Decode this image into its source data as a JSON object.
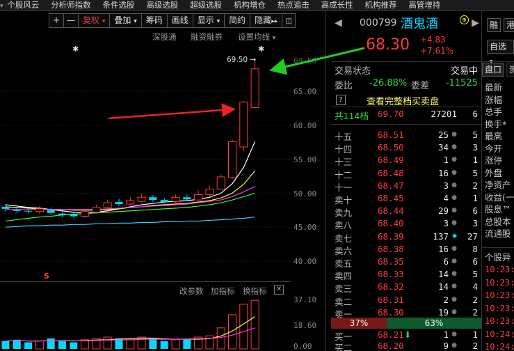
{
  "top_menu": [
    "个股风云",
    "分析师指数",
    "条件选股",
    "高级选股",
    "超级选股",
    "机构增仓",
    "热点追击",
    "高成长性",
    "机构推荐",
    "高管增持"
  ],
  "toolbar": {
    "plus": "+",
    "minus": "—",
    "restore": "复权",
    "overlay": "叠加",
    "chips": "筹码",
    "draw": "画线",
    "display": "显示",
    "simple": "简约",
    "hide": "隐藏"
  },
  "subbar": {
    "sgt": "深股通",
    "margin": "融资融券",
    "ma_settings": "设置均线"
  },
  "price_axis": [
    "65.00",
    "60.00",
    "55.00",
    "50.00",
    "45.00",
    "40.00"
  ],
  "price_axis_top": "69.50",
  "high_label": "69.50",
  "s_marker": "S",
  "vol_bar": {
    "params": "改参数",
    "add_ind": "加指标",
    "switch_ind": "换指标"
  },
  "vol_axis": [
    "37.10",
    "18.60",
    "0.00"
  ],
  "colors": {
    "up": "#ff3a3a",
    "down": "#00d8ff",
    "green": "#33d633",
    "bg": "#000000"
  },
  "chart_data": {
    "type": "candlestick",
    "ylim": [
      37,
      70
    ],
    "candles": [
      {
        "o": 48.0,
        "c": 47.7,
        "h": 48.4,
        "l": 47.3
      },
      {
        "o": 47.6,
        "c": 47.4,
        "h": 48.0,
        "l": 47.1
      },
      {
        "o": 47.4,
        "c": 47.3,
        "h": 47.8,
        "l": 47.0
      },
      {
        "o": 47.3,
        "c": 47.7,
        "h": 48.1,
        "l": 47.0
      },
      {
        "o": 47.5,
        "c": 47.1,
        "h": 47.9,
        "l": 46.8
      },
      {
        "o": 47.0,
        "c": 46.8,
        "h": 47.3,
        "l": 46.5
      },
      {
        "o": 46.9,
        "c": 46.6,
        "h": 47.2,
        "l": 46.4
      },
      {
        "o": 46.6,
        "c": 47.3,
        "h": 47.6,
        "l": 46.4
      },
      {
        "o": 47.2,
        "c": 47.9,
        "h": 48.3,
        "l": 47.0
      },
      {
        "o": 47.9,
        "c": 48.6,
        "h": 49.0,
        "l": 47.7
      },
      {
        "o": 48.7,
        "c": 48.4,
        "h": 49.2,
        "l": 48.1
      },
      {
        "o": 48.4,
        "c": 48.9,
        "h": 49.4,
        "l": 48.2
      },
      {
        "o": 48.8,
        "c": 49.4,
        "h": 49.9,
        "l": 48.6
      },
      {
        "o": 49.4,
        "c": 49.0,
        "h": 49.7,
        "l": 48.7
      },
      {
        "o": 49.0,
        "c": 48.7,
        "h": 49.3,
        "l": 48.5
      },
      {
        "o": 48.8,
        "c": 49.4,
        "h": 49.8,
        "l": 48.6
      },
      {
        "o": 49.4,
        "c": 49.1,
        "h": 49.8,
        "l": 48.9
      },
      {
        "o": 49.0,
        "c": 49.8,
        "h": 50.4,
        "l": 48.9
      },
      {
        "o": 49.8,
        "c": 50.6,
        "h": 51.1,
        "l": 49.6
      },
      {
        "o": 50.6,
        "c": 52.4,
        "h": 52.8,
        "l": 50.5
      },
      {
        "o": 52.3,
        "c": 57.6,
        "h": 57.9,
        "l": 52.1
      },
      {
        "o": 56.8,
        "c": 63.4,
        "h": 63.6,
        "l": 56.2
      },
      {
        "o": 62.6,
        "c": 68.3,
        "h": 69.5,
        "l": 62.4
      }
    ],
    "ma_lines": [
      {
        "color": "#ffffff",
        "values": [
          48.3,
          48.1,
          47.9,
          47.8,
          47.6,
          47.4,
          47.2,
          47.1,
          47.2,
          47.4,
          47.7,
          48.0,
          48.3,
          48.5,
          48.7,
          48.8,
          48.9,
          49.1,
          49.4,
          50.0,
          51.4,
          53.8,
          57.6
        ]
      },
      {
        "color": "#ffff33",
        "values": [
          48.0,
          47.9,
          47.8,
          47.7,
          47.6,
          47.6,
          47.5,
          47.5,
          47.5,
          47.6,
          47.7,
          47.9,
          48.0,
          48.2,
          48.3,
          48.4,
          48.5,
          48.7,
          48.9,
          49.3,
          50.0,
          51.3,
          53.3
        ]
      },
      {
        "color": "#ff33ff",
        "values": [
          47.6,
          47.6,
          47.6,
          47.6,
          47.6,
          47.6,
          47.6,
          47.6,
          47.6,
          47.7,
          47.8,
          47.9,
          48.0,
          48.1,
          48.2,
          48.3,
          48.4,
          48.6,
          48.8,
          49.0,
          49.5,
          50.2,
          51.0
        ]
      },
      {
        "color": "#33ff33",
        "values": [
          45.9,
          46.1,
          46.3,
          46.5,
          46.6,
          46.8,
          46.9,
          47.0,
          47.1,
          47.2,
          47.3,
          47.4,
          47.5,
          47.6,
          47.7,
          47.8,
          47.9,
          48.1,
          48.3,
          48.6,
          49.0,
          49.5,
          50.0
        ]
      },
      {
        "color": "#33ccff",
        "values": [
          45.0,
          45.1,
          45.2,
          45.2,
          45.3,
          45.3,
          45.4,
          45.4,
          45.5,
          45.5,
          45.6,
          45.6,
          45.7,
          45.7,
          45.8,
          45.8,
          45.9,
          45.9,
          46.0,
          46.1,
          46.2,
          46.3,
          46.5
        ]
      }
    ],
    "volume": [
      6,
      7,
      5,
      6,
      8,
      6,
      5,
      7,
      8,
      9,
      8,
      7,
      9,
      8,
      6,
      7,
      7,
      9,
      10,
      16,
      26,
      34,
      37
    ],
    "volume_ylim": [
      0,
      37.1
    ]
  },
  "stock": {
    "code": "000799",
    "name": "酒鬼酒",
    "price": "68.30",
    "change": "+4.83",
    "pct": "+7.61%"
  },
  "status": {
    "label": "交易状态",
    "value": "交易中"
  },
  "weibi": {
    "label": "委比",
    "value": "-26.88%",
    "label2": "委差",
    "value2": "-11525"
  },
  "full_book": {
    "q": "?",
    "text": "查看完整档买卖盘"
  },
  "total_row": {
    "label": "共114档",
    "price": "69.70",
    "vol": "27201",
    "n": "6"
  },
  "order_book_asks": [
    {
      "label": "十五",
      "price": "68.51",
      "vol": "25",
      "n": "5"
    },
    {
      "label": "十四",
      "price": "68.50",
      "vol": "34",
      "n": "3"
    },
    {
      "label": "十三",
      "price": "68.49",
      "vol": "1",
      "n": "1"
    },
    {
      "label": "十二",
      "price": "68.48",
      "vol": "16",
      "n": "5"
    },
    {
      "label": "十一",
      "price": "68.47",
      "vol": "3",
      "n": "2"
    },
    {
      "label": "卖十",
      "price": "68.45",
      "vol": "4",
      "n": "1"
    },
    {
      "label": "卖九",
      "price": "68.44",
      "vol": "29",
      "n": "6"
    },
    {
      "label": "卖八",
      "price": "68.40",
      "vol": "3",
      "n": "3"
    },
    {
      "label": "卖七",
      "price": "68.39",
      "vol": "137",
      "n": "27"
    },
    {
      "label": "卖六",
      "price": "68.38",
      "vol": "16",
      "n": "8"
    },
    {
      "label": "卖五",
      "price": "68.35",
      "vol": "6",
      "n": "6"
    },
    {
      "label": "卖四",
      "price": "68.33",
      "vol": "14",
      "n": "5"
    },
    {
      "label": "卖三",
      "price": "68.32",
      "vol": "14",
      "n": "4"
    },
    {
      "label": "卖二",
      "price": "68.31",
      "vol": "2",
      "n": "2"
    },
    {
      "label": "卖一",
      "price": "68.30",
      "vol": "19",
      "n": "2"
    }
  ],
  "ratio": {
    "sell": "37%",
    "buy": "63%"
  },
  "order_book_bids": [
    {
      "label": "买一",
      "price": "68.21",
      "vol": "1",
      "n": "1"
    },
    {
      "label": "买二",
      "price": "68.20",
      "vol": "9",
      "n": "2"
    }
  ],
  "far_right": {
    "btn1": "融",
    "btn2": "港",
    "btn3": "自选",
    "tab1": "盘口",
    "tab2": "资",
    "items": [
      "最新",
      "涨幅",
      "总手",
      "换手*",
      "最高",
      "今开",
      "涨停",
      "外盘",
      "净资产",
      "收益(一)",
      "股息™",
      "总股本",
      "流通股"
    ],
    "detail_label": "个股异",
    "times": [
      "10:23:",
      "10:23:",
      "10:23:",
      "10:23:",
      "10:23:",
      "10:24:",
      "10:24:"
    ]
  }
}
